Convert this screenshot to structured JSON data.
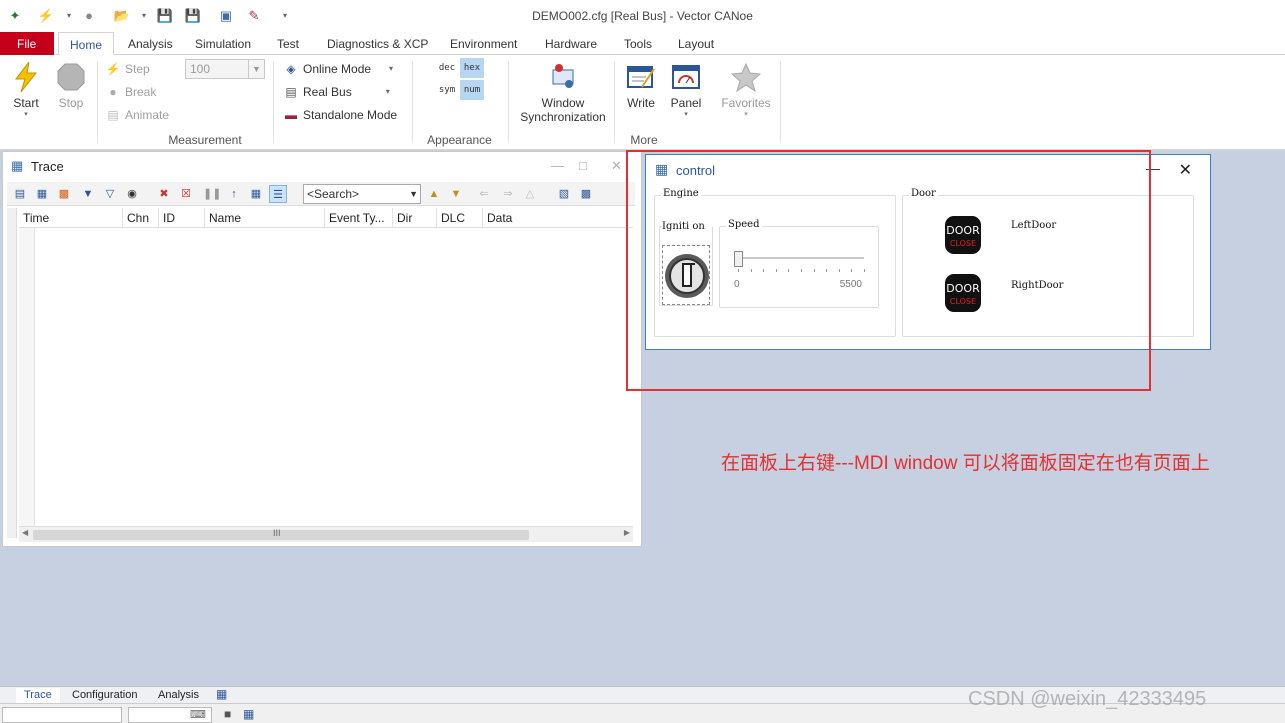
{
  "window": {
    "title": "DEMO002.cfg [Real Bus] - Vector CANoe"
  },
  "ribbon_tabs": [
    "File",
    "Home",
    "Analysis",
    "Simulation",
    "Test",
    "Diagnostics & XCP",
    "Environment",
    "Hardware",
    "Tools",
    "Layout"
  ],
  "measurement": {
    "start_label": "Start",
    "stop_label": "Stop",
    "step_label": "Step",
    "break_label": "Break",
    "animate_label": "Animate",
    "animate_value": "100",
    "online_mode_label": "Online Mode",
    "real_bus_label": "Real Bus",
    "standalone_label": "Standalone Mode",
    "group_label": "Measurement"
  },
  "appearance": {
    "chips": [
      "dec",
      "hex",
      "sym",
      "num"
    ],
    "group_label": "Appearance"
  },
  "more": {
    "window_sync_line1": "Window",
    "window_sync_line2": "Synchronization",
    "write_label": "Write",
    "panel_label": "Panel",
    "favorites_label": "Favorites",
    "group_label": "More"
  },
  "trace": {
    "title": "Trace",
    "search_placeholder": "<Search>",
    "columns": [
      "Time",
      "Chn",
      "ID",
      "Name",
      "Event Ty...",
      "Dir",
      "DLC",
      "Data"
    ],
    "hscroll_grip": "III"
  },
  "control": {
    "title": "control",
    "engine_label": "Engine",
    "ignition_label": "Igniti on",
    "speed_label": "Speed",
    "speed_min": "0",
    "speed_max": "5500",
    "speed_value": 0,
    "door_label": "Door",
    "door_icon_top": "DOOR",
    "door_icon_bottom": "CLOSE",
    "left_door_label": "LeftDoor",
    "right_door_label": "RightDoor"
  },
  "annotation": {
    "text": "在面板上右键---MDI window 可以将面板固定在也有页面上"
  },
  "bottom_tabs": [
    "Trace",
    "Configuration",
    "Analysis"
  ],
  "watermark": "CSDN @weixin_42333495",
  "colors": {
    "file_tab": "#c4001a",
    "accent": "#2b5797",
    "annotation": "#e53030",
    "desktop": "#c6d0e0"
  }
}
